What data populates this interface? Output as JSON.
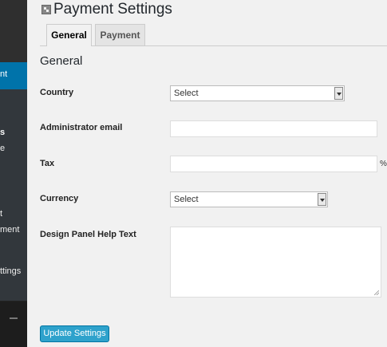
{
  "sidebar": {
    "items": [
      {
        "label": "nt"
      },
      {
        "label": "s"
      },
      {
        "label": "e"
      },
      {
        "label": "t"
      },
      {
        "label": "ment"
      },
      {
        "label": "ttings"
      }
    ]
  },
  "page": {
    "title": "Payment Settings"
  },
  "tabs": [
    {
      "label": "General"
    },
    {
      "label": "Payment"
    }
  ],
  "section": {
    "title": "General"
  },
  "form": {
    "country": {
      "label": "Country",
      "value": "Select"
    },
    "admin_email": {
      "label": "Administrator email",
      "value": ""
    },
    "tax": {
      "label": "Tax",
      "value": "",
      "suffix": "%"
    },
    "currency": {
      "label": "Currency",
      "value": "Select"
    },
    "help_text": {
      "label": "Design Panel Help Text",
      "value": ""
    }
  },
  "actions": {
    "update_label": "Update Settings"
  },
  "colors": {
    "accent": "#0073aa",
    "button": "#2ea2cc",
    "sidebar": "#222222"
  }
}
